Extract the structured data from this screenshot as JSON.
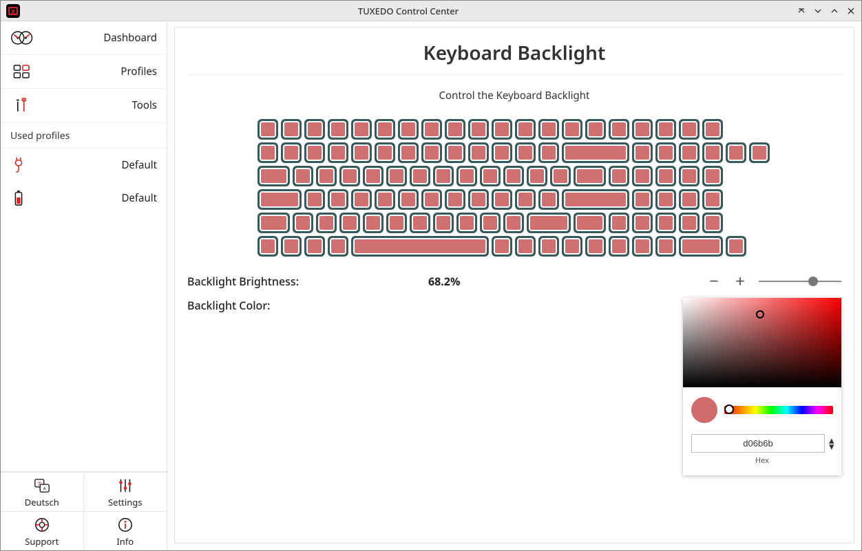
{
  "window_title": "TUXEDO Control Center",
  "sidebar": {
    "items": [
      {
        "label": "Dashboard"
      },
      {
        "label": "Profiles"
      },
      {
        "label": "Tools"
      }
    ],
    "used_heading": "Used profiles",
    "profiles": [
      {
        "label": "Default"
      },
      {
        "label": "Default"
      }
    ]
  },
  "bottom": [
    {
      "label": "Deutsch"
    },
    {
      "label": "Settings"
    },
    {
      "label": "Support"
    },
    {
      "label": "Info"
    }
  ],
  "page": {
    "title": "Keyboard Backlight",
    "subtitle": "Control the Keyboard Backlight",
    "brightness_label": "Backlight Brightness:",
    "brightness_value": "68.2%",
    "brightness_fraction": 0.682,
    "color_label": "Backlight Color:",
    "color_hex": "d06b6b",
    "hex_label": "Hex"
  },
  "keyboard_color": "#d07070",
  "keyboard_layout": [
    [
      30,
      30,
      30,
      30,
      30,
      30,
      30,
      30,
      30,
      30,
      30,
      30,
      30,
      30,
      30,
      30,
      30,
      30,
      30,
      30
    ],
    [
      30,
      30,
      30,
      30,
      30,
      30,
      30,
      30,
      30,
      30,
      30,
      30,
      30,
      98,
      30,
      30,
      30,
      30,
      30,
      30
    ],
    [
      47,
      30,
      30,
      30,
      30,
      30,
      30,
      30,
      30,
      30,
      30,
      30,
      30,
      47,
      0,
      30,
      30,
      30,
      30,
      30
    ],
    [
      64,
      30,
      30,
      30,
      30,
      30,
      30,
      30,
      30,
      30,
      30,
      30,
      98,
      0,
      0,
      0,
      30,
      30,
      30,
      30
    ],
    [
      47,
      30,
      30,
      30,
      30,
      30,
      30,
      30,
      30,
      30,
      30,
      64,
      47,
      0,
      30,
      0,
      30,
      30,
      30,
      30
    ],
    [
      30,
      30,
      30,
      30,
      200,
      30,
      30,
      30,
      0,
      0,
      30,
      30,
      0,
      30,
      30,
      30,
      64,
      30,
      0,
      0
    ]
  ]
}
